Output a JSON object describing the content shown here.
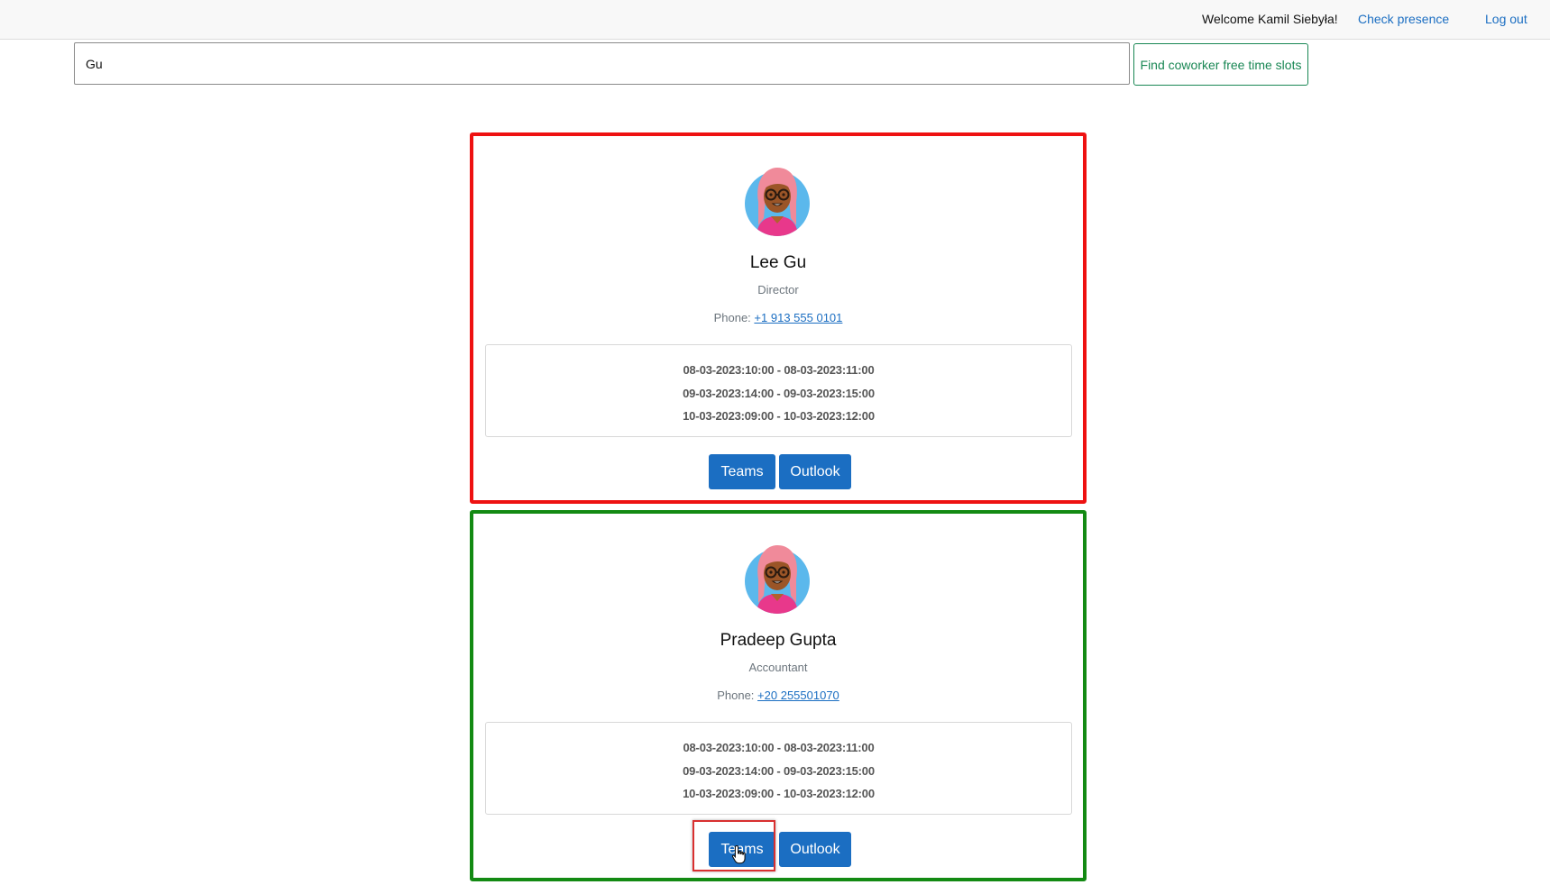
{
  "header": {
    "welcome": "Welcome Kamil Siebyła!",
    "check_presence": "Check presence",
    "logout": "Log out"
  },
  "search": {
    "value": "Gu",
    "button_label": "Find coworker free time slots"
  },
  "colors": {
    "accent": "#1b6ec2",
    "success": "#198754",
    "card1_border": "#ee1111",
    "card2_border": "#138a13"
  },
  "cards": [
    {
      "name": "Lee Gu",
      "title": "Director",
      "phone_label": "Phone:",
      "phone": "+1 913 555 0101",
      "slots": [
        "08-03-2023:10:00 - 08-03-2023:11:00",
        "09-03-2023:14:00 - 09-03-2023:15:00",
        "10-03-2023:09:00 - 10-03-2023:12:00"
      ],
      "buttons": {
        "teams": "Teams",
        "outlook": "Outlook"
      }
    },
    {
      "name": "Pradeep Gupta",
      "title": "Accountant",
      "phone_label": "Phone:",
      "phone": "+20 255501070",
      "slots": [
        "08-03-2023:10:00 - 08-03-2023:11:00",
        "09-03-2023:14:00 - 09-03-2023:15:00",
        "10-03-2023:09:00 - 10-03-2023:12:00"
      ],
      "buttons": {
        "teams": "Teams",
        "outlook": "Outlook"
      }
    }
  ],
  "icons": {
    "avatar": "avatar-icon",
    "cursor": "hand-pointer-icon"
  }
}
